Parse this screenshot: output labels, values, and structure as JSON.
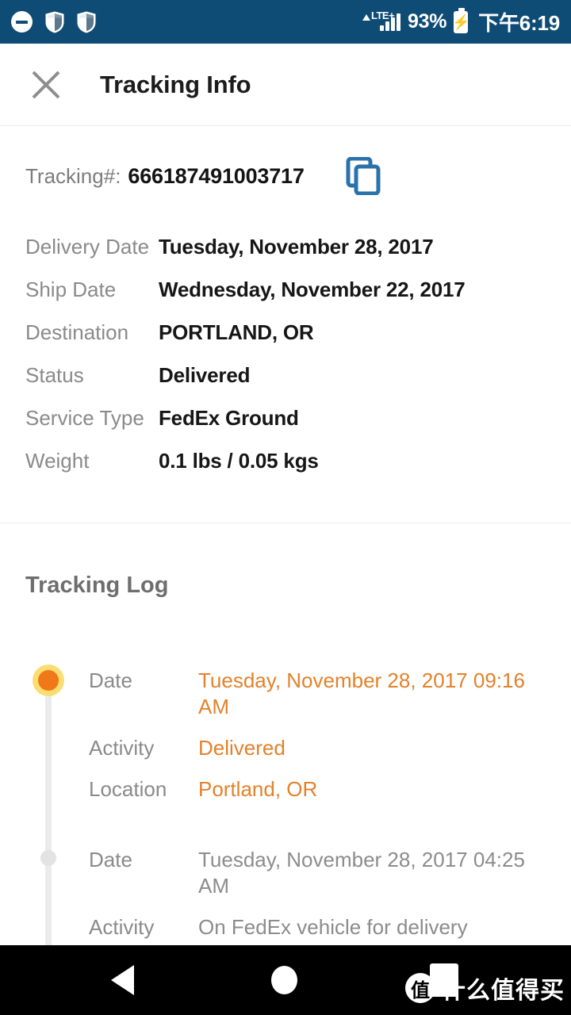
{
  "status_bar": {
    "background": "#0f4c75",
    "left_icons": [
      "minus-circle-icon",
      "shield-icon",
      "shield-icon"
    ],
    "network_triangle": "▲",
    "network_label": "LTE+",
    "signal_bars": 4,
    "battery_percent": "93%",
    "battery_charging": true,
    "clock": "下午6:19"
  },
  "header": {
    "close_icon": "close-icon",
    "title": "Tracking Info"
  },
  "tracking": {
    "label": "Tracking#:",
    "number": "666187491003717",
    "copy_icon": "copy-icon",
    "copy_icon_color": "#2a72ab"
  },
  "details": {
    "rows": [
      {
        "label": "Delivery Date",
        "value": "Tuesday, November 28, 2017"
      },
      {
        "label": "Ship Date",
        "value": "Wednesday, November 22, 2017"
      },
      {
        "label": "Destination",
        "value": "PORTLAND, OR"
      },
      {
        "label": "Status",
        "value": "Delivered"
      },
      {
        "label": "Service Type",
        "value": "FedEx Ground"
      },
      {
        "label": "Weight",
        "value": "0.1 lbs / 0.05 kgs"
      }
    ]
  },
  "log": {
    "title": "Tracking Log",
    "active_color": "#f07818",
    "active_ring_color": "#fbdd72",
    "entries": [
      {
        "state": "active",
        "date_label": "Date",
        "date_value": "Tuesday, November 28, 2017 09:16 AM",
        "activity_label": "Activity",
        "activity_value": "Delivered",
        "location_label": "Location",
        "location_value": "Portland, OR"
      },
      {
        "state": "past",
        "date_label": "Date",
        "date_value": "Tuesday, November 28, 2017 04:25 AM",
        "activity_label": "Activity",
        "activity_value": "On FedEx vehicle for delivery"
      }
    ]
  },
  "nav_bar": {
    "back_icon": "back-triangle-icon",
    "home_icon": "home-circle-icon",
    "recents_icon": "recents-square-icon",
    "watermark_logo": "值",
    "watermark_text": "什么值得买"
  }
}
